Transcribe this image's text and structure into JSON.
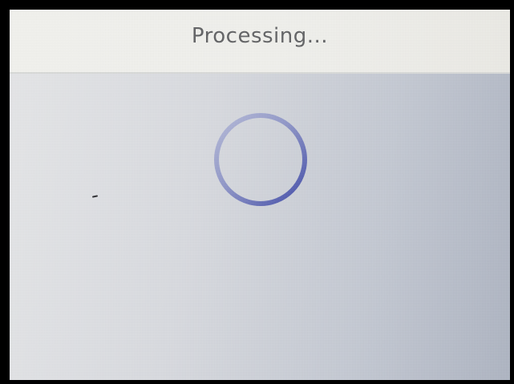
{
  "dialog": {
    "title": "Processing..."
  },
  "spinner": {
    "icon": "loading-spinner-icon",
    "color": "#4a55b0"
  },
  "colors": {
    "header_background": "#f1f1ed",
    "body_background": "#d3d6dd",
    "title_text": "#5f6062",
    "frame": "#000000"
  }
}
